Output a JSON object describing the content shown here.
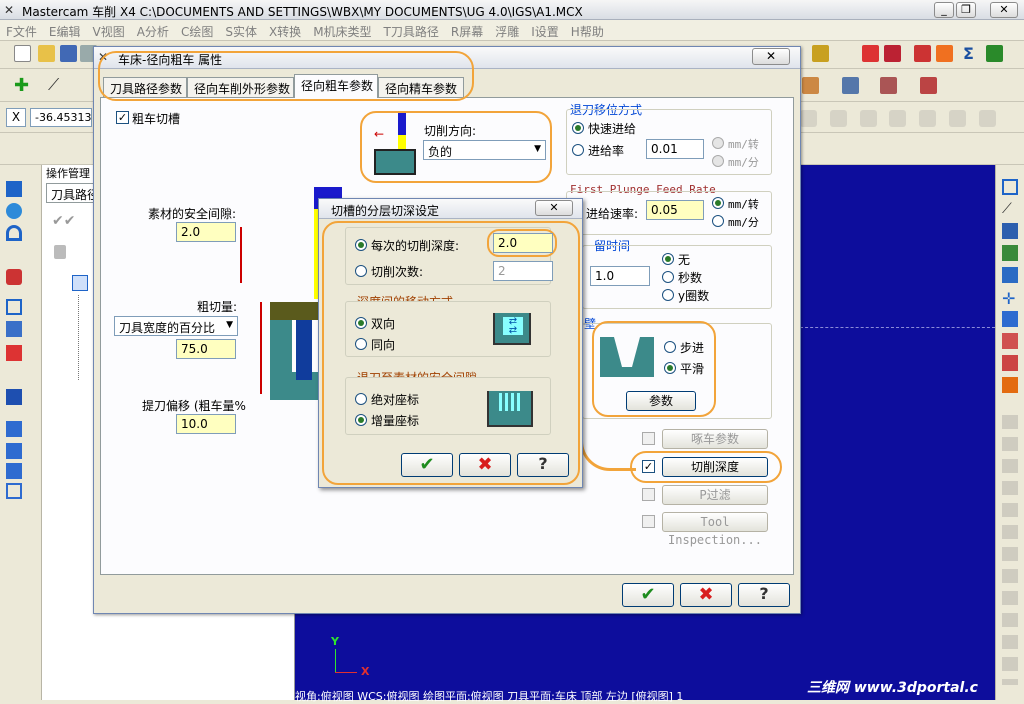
{
  "app": {
    "title": "Mastercam 车削  X4  C:\\DOCUMENTS AND SETTINGS\\WBX\\MY DOCUMENTS\\UG 4.0\\IGS\\A1.MCX",
    "menu": [
      "F文件",
      "E编辑",
      "V视图",
      "A分析",
      "C绘图",
      "S实体",
      "X转换",
      "M机床类型",
      "T刀具路径",
      "R屏幕",
      "浮雕",
      "I设置",
      "H帮助"
    ],
    "coord_value": "-36.45313",
    "opmgr_title": "操作管理",
    "opmgr_tab": "刀具路径",
    "status_text": "视角:俯视图   WCS:俯视图   绘图平面:俯视图   刀具平面:车床 顶部 左边 [俯视图] 1",
    "watermark": "三维网 www.3dportal.c",
    "axis_y": "Y",
    "axis_x": "X"
  },
  "dialog": {
    "title": "车床-径向粗车 属性",
    "tabs": [
      "刀具路径参数",
      "径向车削外形参数",
      "径向粗车参数",
      "径向精车参数"
    ],
    "active_tab": 2,
    "rough_groove_label": "粗车切槽",
    "rough_groove_checked": true,
    "cut_direction_label": "切削方向:",
    "cut_direction_value": "负的",
    "stock_clearance_label": "素材的安全间隙:",
    "stock_clearance_value": "2.0",
    "rough_step_label": "粗切量:",
    "rough_step_mode": "刀具宽度的百分比",
    "rough_step_value": "75.0",
    "backoff_label": "提刀偏移 (粗车量%",
    "backoff_value": "10.0",
    "retract": {
      "title": "退刀移位方式",
      "rapid": "快速进给",
      "feed": "进给率",
      "feed_value": "0.01",
      "unit1": "mm/转",
      "unit2": "mm/分"
    },
    "plunge": {
      "title": "First Plunge Feed Rate",
      "rate_label": "进给速率:",
      "rate_value": "0.05",
      "unit1": "mm/转",
      "unit2": "mm/分"
    },
    "dwell": {
      "title": "留时间",
      "value": "1.0",
      "opt_none": "无",
      "opt_sec": "秒数",
      "opt_rev": "y圈数"
    },
    "wall": {
      "title": "壁",
      "opt_step": "步进",
      "opt_smooth": "平滑",
      "params_button": "参数"
    },
    "peck_button": "啄车参数",
    "depth_cut_button": "切削深度",
    "filter_button": "P过滤",
    "tool_inspection_button": "Tool Inspection..."
  },
  "subdialog": {
    "title": "切槽的分层切深设定",
    "per_cut_depth_label": "每次的切削深度:",
    "per_cut_depth_value": "2.0",
    "num_cuts_label": "切削次数:",
    "num_cuts_value": "2",
    "move_group_title": "深度间的移动方式",
    "bidir": "双向",
    "unidir": "同向",
    "retract_group_title": "退刀至素材的安全间隙",
    "absolute": "绝对座标",
    "incremental": "增量座标"
  },
  "colors": {
    "graphics_bg": "#0d0d9c",
    "highlight": "#f2a43a",
    "input_yellow": "#ffffc0"
  }
}
